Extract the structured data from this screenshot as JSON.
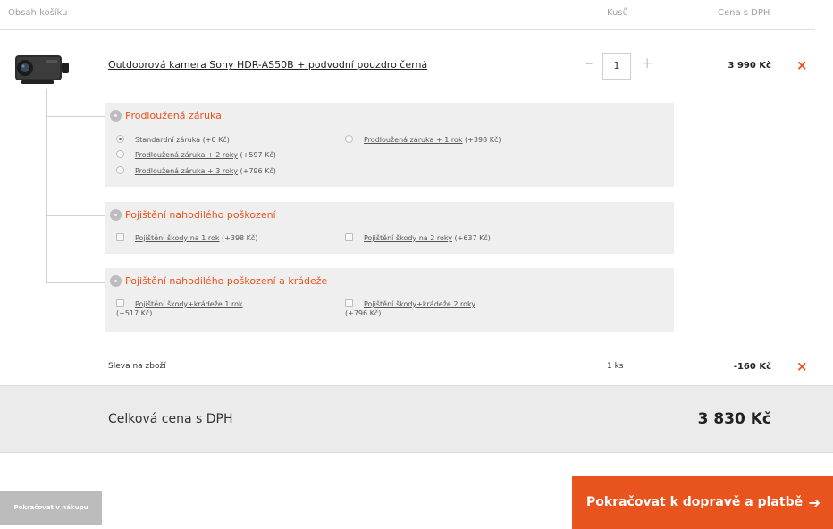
{
  "header": {
    "cart_contents": "Obsah košíku",
    "quantity": "Kusů",
    "price_vat": "Cena s DPH"
  },
  "product": {
    "name": "Outdoorová kamera Sony HDR-AS50B + podvodní pouzdro černá",
    "quantity": "1",
    "minus": "–",
    "plus": "+",
    "price": "3 990 Kč",
    "remove": "×"
  },
  "warranty": {
    "title": "Prodloužená záruka",
    "options": [
      {
        "label": "Standardní záruka",
        "price": " (+0 Kč)",
        "checked": true
      },
      {
        "label": "Prodloužená záruka + 1 rok",
        "price": " (+398 Kč)"
      },
      {
        "label": "Prodloužená záruka + 2 roky",
        "price": " (+597 Kč)"
      },
      {
        "label": "Prodloužená záruka + 3 roky",
        "price": " (+796 Kč)"
      }
    ]
  },
  "damage_insurance": {
    "title": "Pojištění nahodilého poškození",
    "options": [
      {
        "label": "Pojištění škody na 1 rok",
        "price": " (+398 Kč)"
      },
      {
        "label": "Pojištění škody na 2 roky",
        "price": " (+637 Kč)"
      }
    ]
  },
  "theft_insurance": {
    "title": "Pojištění nahodilého poškození a krádeže",
    "options": [
      {
        "label": "Pojištění škody+krádeže 1 rok",
        "price": "(+517 Kč)"
      },
      {
        "label": "Pojištění škody+krádeže 2 roky",
        "price": "(+796 Kč)"
      }
    ]
  },
  "discount": {
    "label": "Sleva na zboží",
    "quantity": "1 ks",
    "price": "-160 Kč",
    "remove": "×"
  },
  "total": {
    "label": "Celková cena s DPH",
    "value": "3 830 Kč"
  },
  "buttons": {
    "continue_shopping": "Pokračovat v nákupu",
    "continue_checkout": "Pokračovat k dopravě a platbě",
    "arrow": "➔"
  },
  "colors": {
    "accent": "#e9531d",
    "panel": "#efefef",
    "total_band": "#ebebeb",
    "secondary_button": "#bcbcbc"
  }
}
